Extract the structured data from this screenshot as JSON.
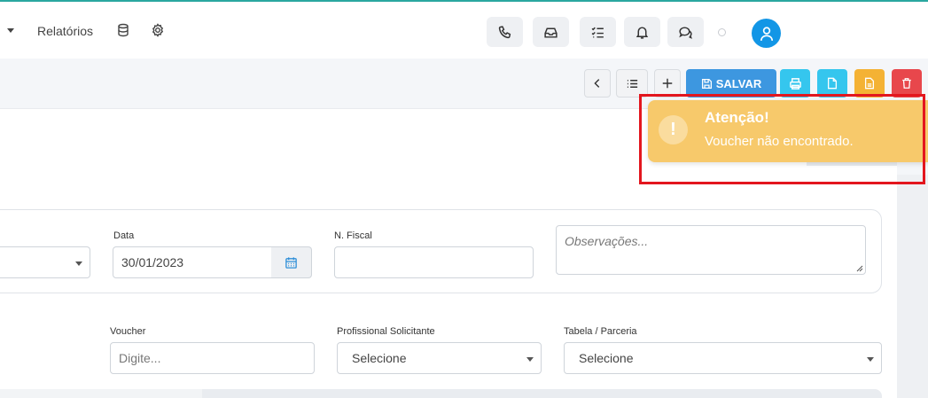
{
  "nav": {
    "reports_label": "Relatórios",
    "icons": [
      "database-icon",
      "gear-icon"
    ]
  },
  "toolbar_icons": [
    "phone-icon",
    "inbox-icon",
    "tasks-icon",
    "bell-icon",
    "chat-icon"
  ],
  "actions": {
    "save_label": "SALVAR",
    "colors": {
      "save": "#3d97e0",
      "print": "#35c6ee",
      "document": "#35c6ee",
      "export": "#f4b234",
      "delete": "#e8474c"
    }
  },
  "form": {
    "date_label": "Data",
    "date_value": "30/01/2023",
    "fiscal_label": "N. Fiscal",
    "fiscal_value": "",
    "notes_placeholder": "Observações...",
    "voucher_label": "Voucher",
    "voucher_placeholder": "Digite...",
    "professional_label": "Profissional Solicitante",
    "professional_value": "Selecione",
    "table_label": "Tabela / Parceria",
    "table_value": "Selecione"
  },
  "toast": {
    "title": "Atenção!",
    "message": "Voucher não encontrado.",
    "icon": "!",
    "color": "#f7c96b",
    "highlight_color": "#e3161e"
  }
}
